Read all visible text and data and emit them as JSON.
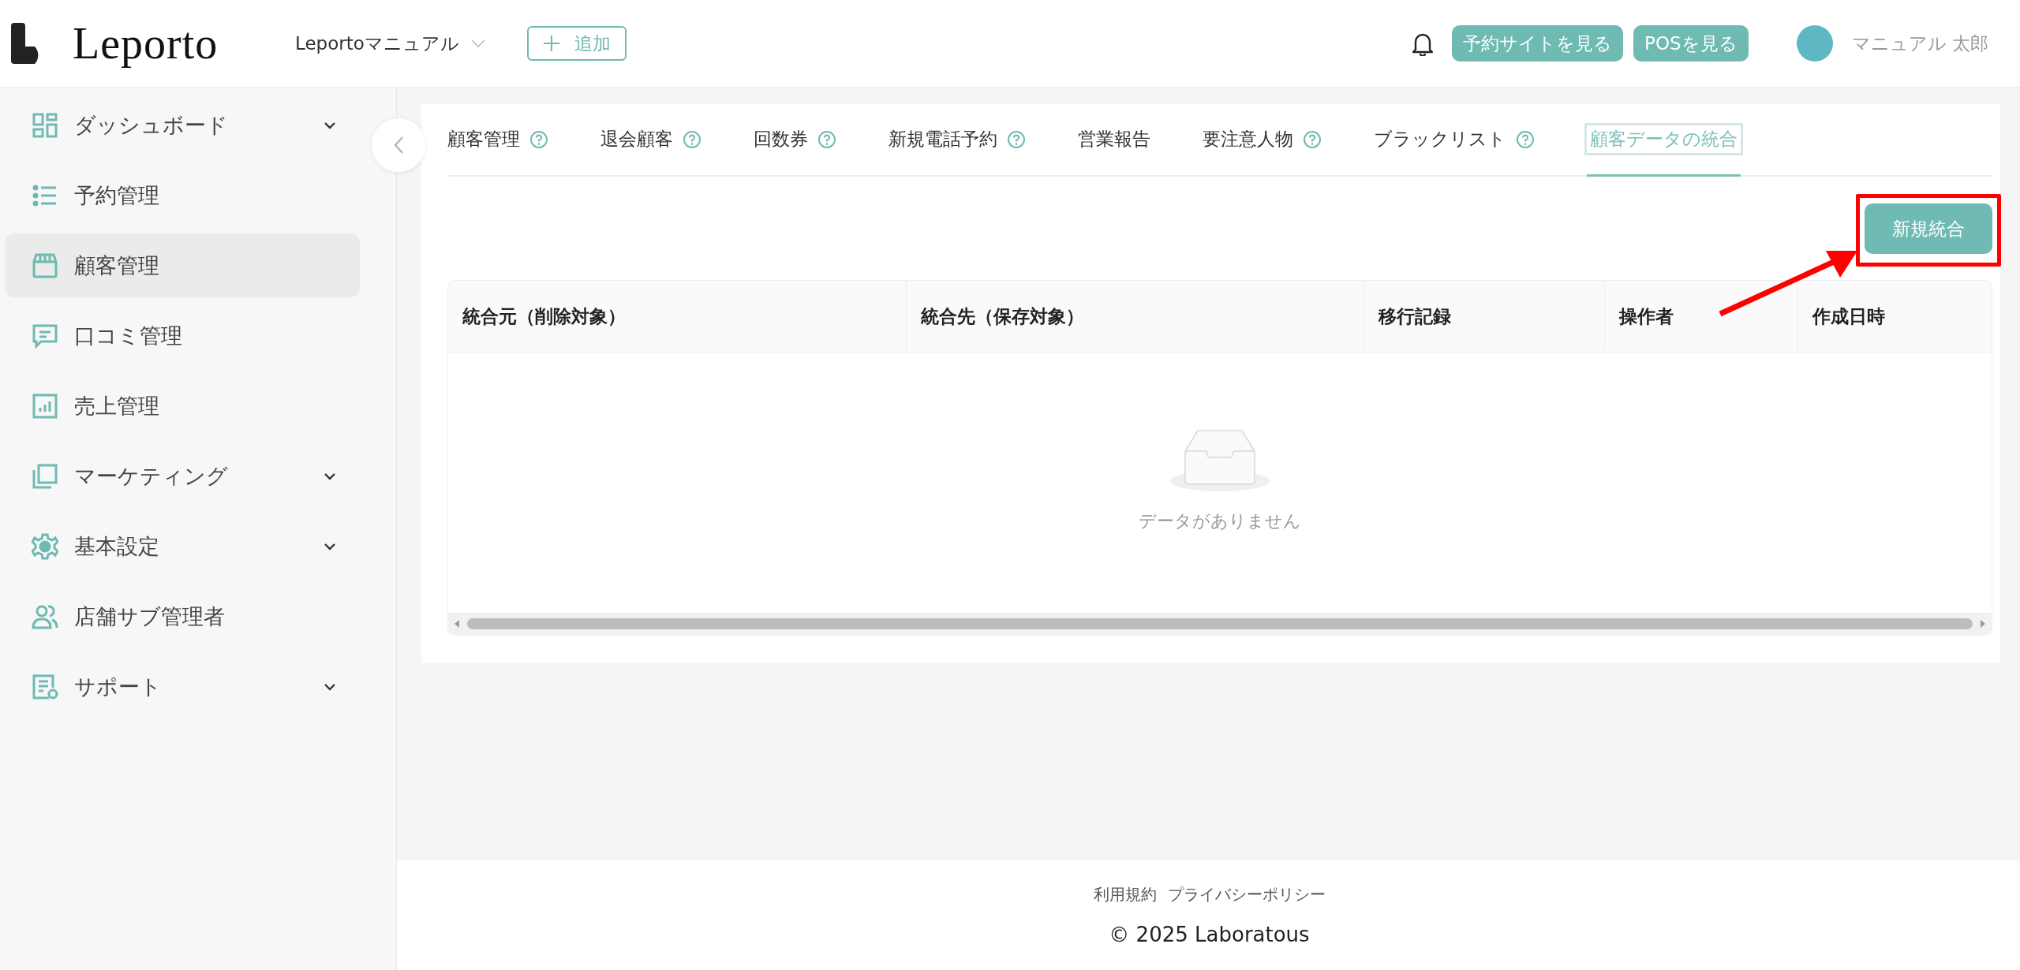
{
  "header": {
    "logo": "Leporto",
    "shop_selector": "Leportoマニュアル",
    "add_button": "追加",
    "buttons": [
      "予約サイトを見る",
      "POSを見る"
    ],
    "user_name": "マニュアル 太郎"
  },
  "sidebar": {
    "items": [
      {
        "label": "ダッシュボード",
        "selected": false,
        "has_submenu": true
      },
      {
        "label": "予約管理",
        "selected": false,
        "has_submenu": false
      },
      {
        "label": "顧客管理",
        "selected": true,
        "has_submenu": false
      },
      {
        "label": "口コミ管理",
        "selected": false,
        "has_submenu": false
      },
      {
        "label": "売上管理",
        "selected": false,
        "has_submenu": false
      },
      {
        "label": "マーケティング",
        "selected": false,
        "has_submenu": true
      },
      {
        "label": "基本設定",
        "selected": false,
        "has_submenu": true
      },
      {
        "label": "店舗サブ管理者",
        "selected": false,
        "has_submenu": false
      },
      {
        "label": "サポート",
        "selected": false,
        "has_submenu": true
      }
    ]
  },
  "tabs": [
    {
      "label": "顧客管理",
      "help": true,
      "selected": false
    },
    {
      "label": "退会顧客",
      "help": true,
      "selected": false
    },
    {
      "label": "回数券",
      "help": true,
      "selected": false
    },
    {
      "label": "新規電話予約",
      "help": true,
      "selected": false
    },
    {
      "label": "営業報告",
      "help": false,
      "selected": false
    },
    {
      "label": "要注意人物",
      "help": true,
      "selected": false
    },
    {
      "label": "ブラックリスト",
      "help": true,
      "selected": false
    },
    {
      "label": "顧客データの統合",
      "help": false,
      "selected": true
    }
  ],
  "new_button": "新規統合",
  "table": {
    "columns": [
      "統合元（削除対象）",
      "統合先（保存対象）",
      "移行記録",
      "操作者",
      "作成日時"
    ],
    "empty_text": "データがありません"
  },
  "footer": {
    "links": [
      "利用規約",
      "プライバシーポリシー"
    ],
    "copyright": "© 2025 Laboratous"
  }
}
